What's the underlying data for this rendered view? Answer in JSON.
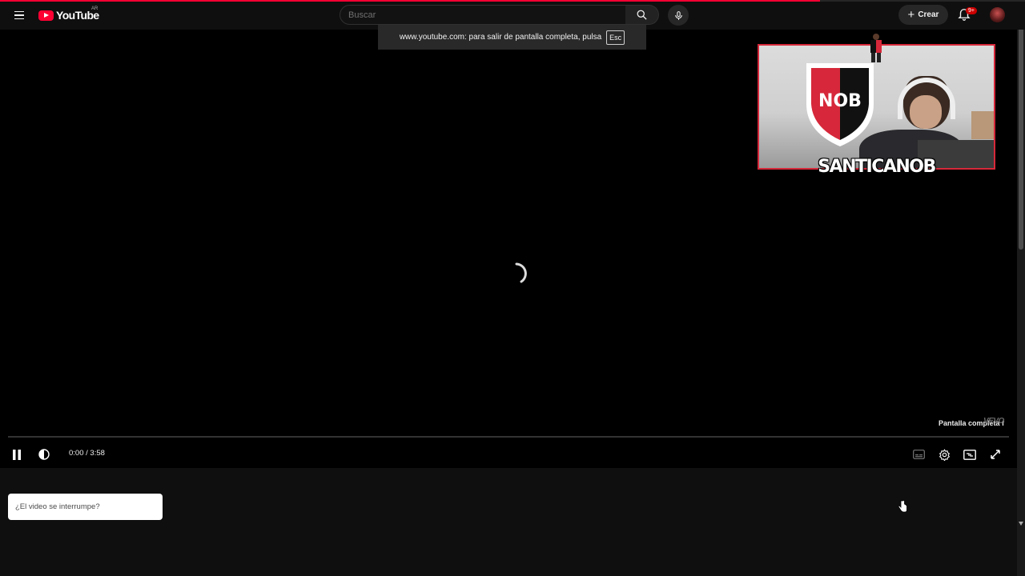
{
  "masthead": {
    "logo_text": "YouTube",
    "country_code": "AR",
    "search_placeholder": "Buscar",
    "create_label": "Crear",
    "notification_badge": "9+"
  },
  "fullscreen_toast": {
    "message": "www.youtube.com: para salir de pantalla completa, pulsa",
    "key": "Esc"
  },
  "player": {
    "webcam_name": "SANTICANOB",
    "shield_text": "NOB",
    "fullscreen_tooltip": "Pantalla completa",
    "fullscreen_tooltip_key": "f",
    "watermark": "VEVO",
    "current_time": "0:00",
    "duration": "3:58",
    "time_display": "0:00 / 3:58",
    "progress": 0,
    "page_load_progress": 0.8
  },
  "below": {
    "interrupt_label": "¿El video se interrumpe?"
  },
  "colors": {
    "brand_red": "#ff0033",
    "background": "#0f0f0f",
    "player_bg": "#000000",
    "webcam_border": "#d6283a"
  },
  "icons": [
    "menu-icon",
    "youtube-logo-icon",
    "search-icon",
    "mic-icon",
    "plus-icon",
    "bell-icon",
    "pause-icon",
    "volume-icon",
    "subtitles-icon",
    "settings-icon",
    "theater-icon",
    "exit-fullscreen-icon"
  ]
}
